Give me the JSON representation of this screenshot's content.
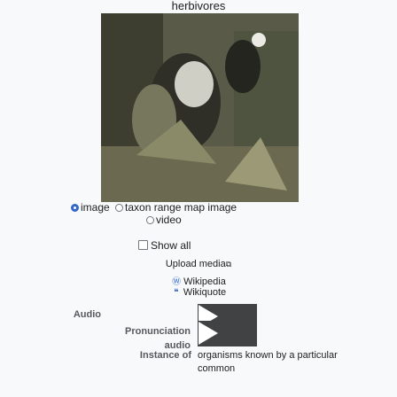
{
  "header": {
    "title": "herbivores"
  },
  "media_selector": {
    "image_label": "image",
    "taxon_range_map_label": "taxon range map image",
    "video_label": "video",
    "show_all_label": "Show all",
    "upload_label": "Upload media",
    "wikipedia_label": "Wikipedia",
    "wikiquote_label": "Wikiquote"
  },
  "properties": {
    "audio_label": "Audio",
    "pronunciation_label_1": "Pronunciation",
    "pronunciation_label_2": "audio",
    "instance_of_label": "Instance of",
    "instance_of_value": "organisms known by a particular common"
  },
  "colors": {
    "link": "#3366cc",
    "player": "#404244",
    "label": "#54595d"
  },
  "icons": [
    "external-link-icon",
    "wikipedia-icon",
    "wikiquote-icon",
    "play-icon"
  ]
}
